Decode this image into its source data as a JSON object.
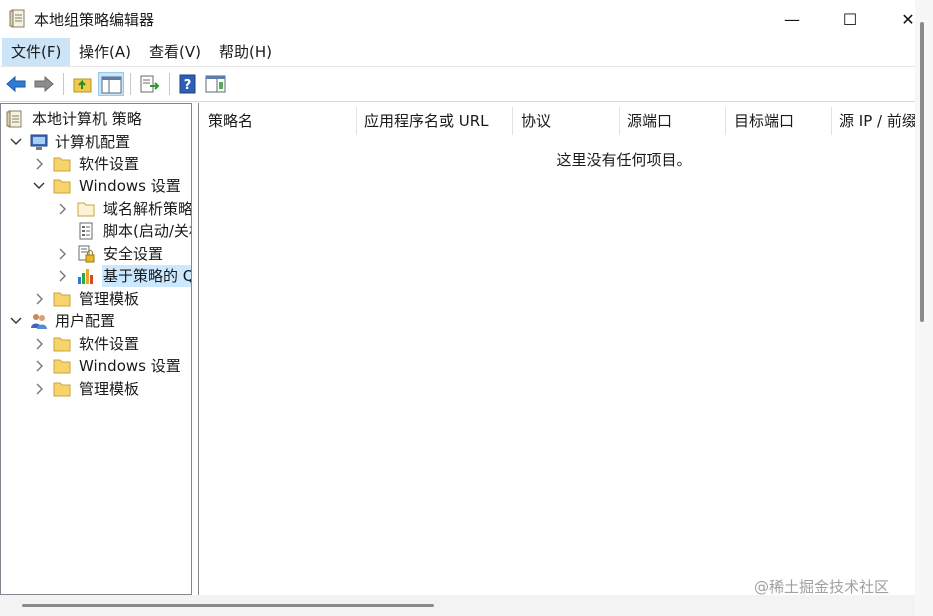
{
  "window": {
    "title": "本地组策略编辑器"
  },
  "window_controls": {
    "minimize": "—",
    "maximize": "☐",
    "close": "✕"
  },
  "menu": {
    "items": [
      "文件(F)",
      "操作(A)",
      "查看(V)",
      "帮助(H)"
    ]
  },
  "toolbar": {
    "buttons": [
      "back-icon",
      "forward-icon",
      "up-folder-icon",
      "show-hide-tree-icon",
      "export-list-icon",
      "help-icon",
      "properties-icon"
    ]
  },
  "tree": {
    "root": "本地计算机 策略",
    "computer_config": "计算机配置",
    "cc_software": "软件设置",
    "cc_windows": "Windows 设置",
    "cc_dns": "域名解析策略",
    "cc_scripts": "脚本(启动/关机)",
    "cc_security": "安全设置",
    "cc_qos": "基于策略的 QoS",
    "cc_admin": "管理模板",
    "user_config": "用户配置",
    "uc_software": "软件设置",
    "uc_windows": "Windows 设置",
    "uc_admin": "管理模板"
  },
  "list": {
    "columns": [
      "策略名",
      "应用程序名或 URL",
      "协议",
      "源端口",
      "目标端口",
      "源 IP / 前缀"
    ],
    "empty_message": "这里没有任何项目。"
  },
  "watermark": "@稀土掘金技术社区",
  "colors": {
    "selection": "#cce8ff",
    "menu_active": "#cce4f7",
    "toolbar_arrow": "#2e7cd6"
  }
}
